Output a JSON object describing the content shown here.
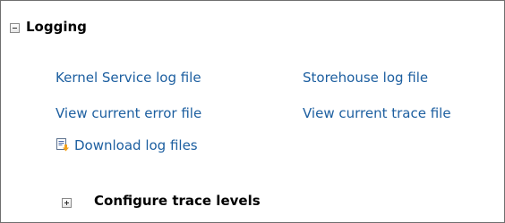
{
  "logging": {
    "title": "Logging",
    "toggle": "collapse",
    "links": {
      "kernel_service_log": "Kernel Service log file",
      "storehouse_log": "Storehouse log file",
      "view_error_file": "View current error file",
      "view_trace_file": "View current trace file",
      "download_logs": "Download log files"
    },
    "download_icon": "download-document-icon"
  },
  "trace": {
    "title": "Configure trace levels",
    "toggle": "expand"
  }
}
